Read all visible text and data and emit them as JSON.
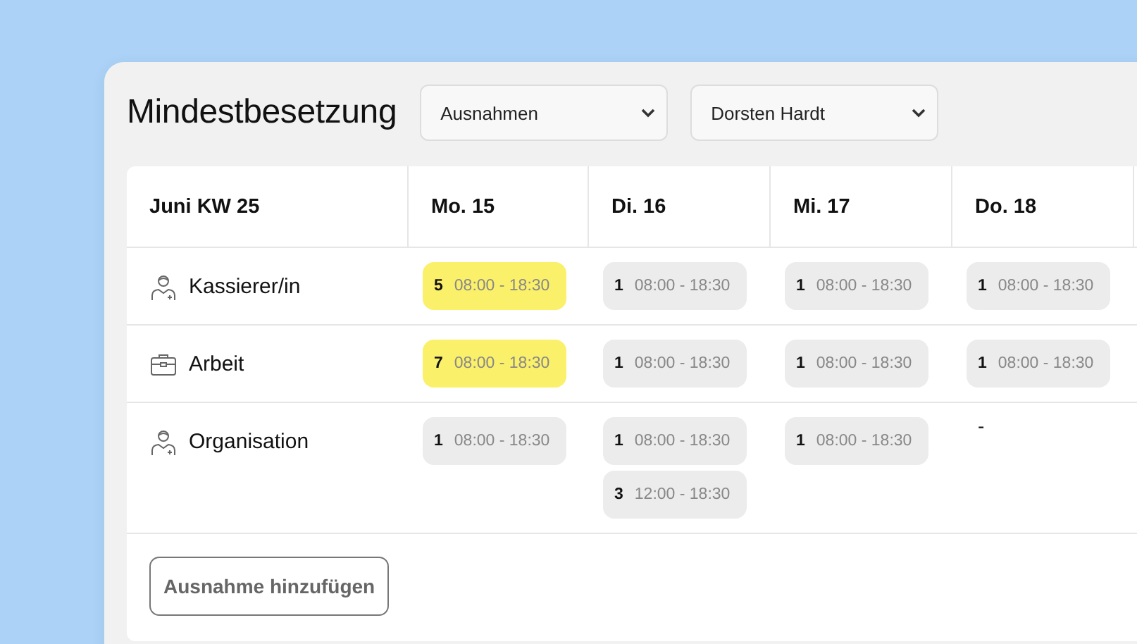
{
  "title": "Mindestbesetzung",
  "filters": [
    {
      "value": "Ausnahmen"
    },
    {
      "value": "Dorsten Hardt"
    }
  ],
  "table": {
    "week": "Juni KW 25",
    "columns": [
      "Mo. 15",
      "Di. 16",
      "Mi. 17",
      "Do. 18"
    ],
    "rows": [
      {
        "label": "Kassierer/in",
        "kind": "person",
        "cells": [
          [
            {
              "count": "5",
              "time": "08:00 - 18:30",
              "highlighted": true
            }
          ],
          [
            {
              "count": "1",
              "time": "08:00 - 18:30",
              "highlighted": false
            }
          ],
          [
            {
              "count": "1",
              "time": "08:00 - 18:30",
              "highlighted": false
            }
          ],
          [
            {
              "count": "1",
              "time": "08:00 - 18:30",
              "highlighted": false
            }
          ]
        ]
      },
      {
        "label": "Arbeit",
        "kind": "briefcase",
        "cells": [
          [
            {
              "count": "7",
              "time": "08:00 - 18:30",
              "highlighted": true
            }
          ],
          [
            {
              "count": "1",
              "time": "08:00 - 18:30",
              "highlighted": false
            }
          ],
          [
            {
              "count": "1",
              "time": "08:00 - 18:30",
              "highlighted": false
            }
          ],
          [
            {
              "count": "1",
              "time": "08:00 - 18:30",
              "highlighted": false
            }
          ]
        ]
      },
      {
        "label": "Organisation",
        "kind": "person",
        "cells": [
          [
            {
              "count": "1",
              "time": "08:00 - 18:30",
              "highlighted": false
            }
          ],
          [
            {
              "count": "1",
              "time": "08:00 - 18:30",
              "highlighted": false
            },
            {
              "count": "3",
              "time": "12:00 - 18:30",
              "highlighted": false
            }
          ],
          [
            {
              "count": "1",
              "time": "08:00 - 18:30",
              "highlighted": false
            }
          ],
          "-"
        ]
      }
    ]
  },
  "add_button": "Ausnahme hinzufügen"
}
